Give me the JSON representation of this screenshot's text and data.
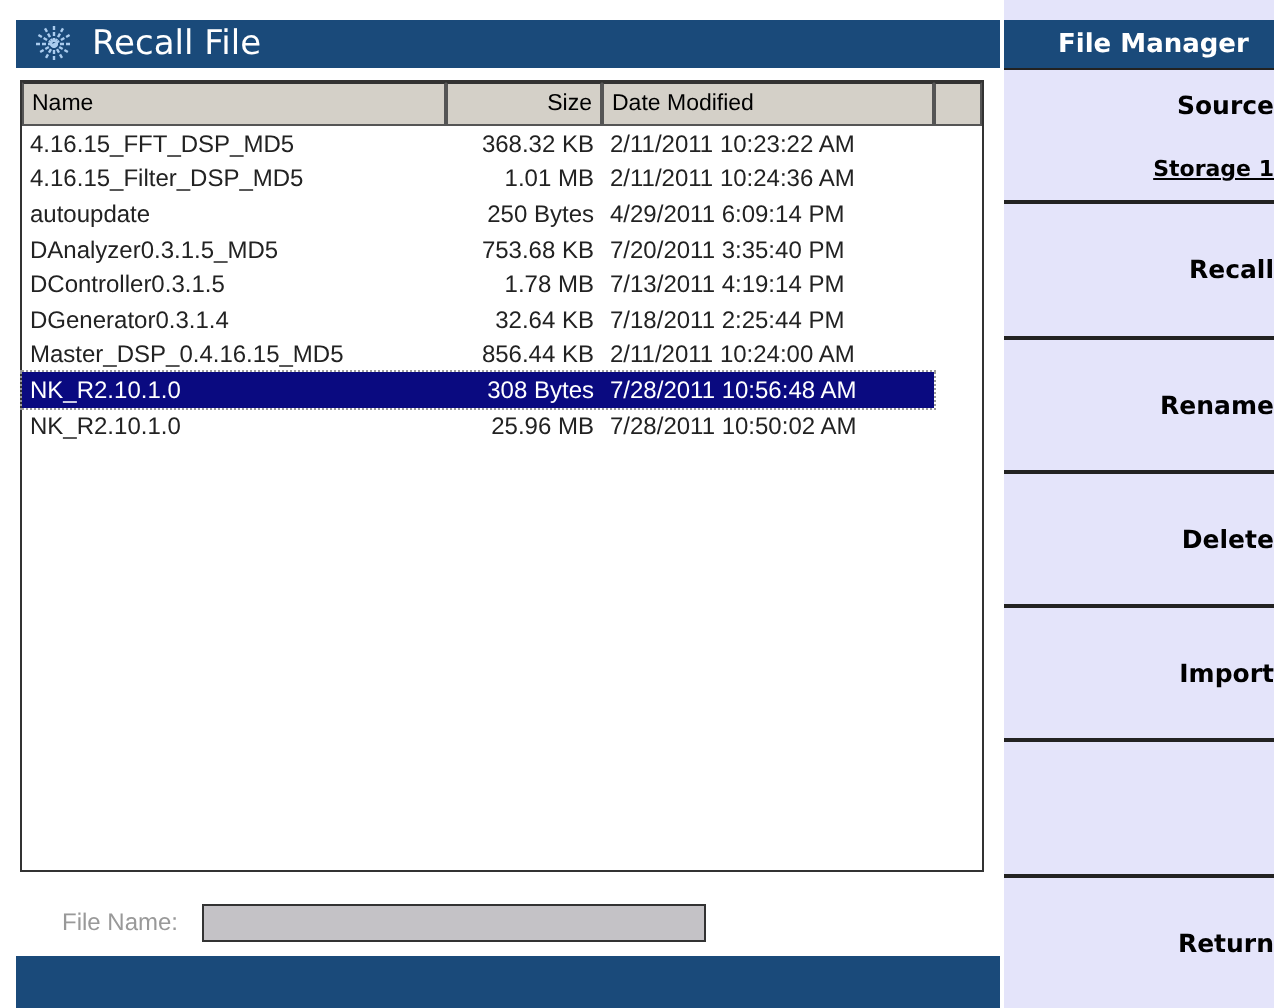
{
  "title": "Recall File",
  "table": {
    "columns": [
      "Name",
      "Size",
      "Date Modified"
    ],
    "rows": [
      {
        "name": "4.16.15_FFT_DSP_MD5",
        "size": "368.32 KB",
        "date": "2/11/2011 10:23:22 AM",
        "selected": false
      },
      {
        "name": "4.16.15_Filter_DSP_MD5",
        "size": "1.01 MB",
        "date": "2/11/2011 10:24:36 AM",
        "selected": false
      },
      {
        "name": "autoupdate",
        "size": "250 Bytes",
        "date": "4/29/2011 6:09:14 PM",
        "selected": false
      },
      {
        "name": "DAnalyzer0.3.1.5_MD5",
        "size": "753.68 KB",
        "date": "7/20/2011 3:35:40 PM",
        "selected": false
      },
      {
        "name": "DController0.3.1.5",
        "size": "1.78 MB",
        "date": "7/13/2011 4:19:14 PM",
        "selected": false
      },
      {
        "name": "DGenerator0.3.1.4",
        "size": "32.64 KB",
        "date": "7/18/2011 2:25:44 PM",
        "selected": false
      },
      {
        "name": "Master_DSP_0.4.16.15_MD5",
        "size": "856.44 KB",
        "date": "2/11/2011 10:24:00 AM",
        "selected": false
      },
      {
        "name": "NK_R2.10.1.0",
        "size": "308 Bytes",
        "date": "7/28/2011 10:56:48 AM",
        "selected": true
      },
      {
        "name": "NK_R2.10.1.0",
        "size": "25.96 MB",
        "date": "7/28/2011 10:50:02 AM",
        "selected": false
      }
    ]
  },
  "file_name": {
    "label": "File Name:"
  },
  "menu": {
    "title": "File Manager",
    "softkeys": [
      {
        "kind": "choice",
        "label": "Source",
        "value": "Storage 1"
      },
      {
        "kind": "action",
        "label": "Recall"
      },
      {
        "kind": "action",
        "label": "Rename"
      },
      {
        "kind": "action",
        "label": "Delete"
      },
      {
        "kind": "action",
        "label": "Import"
      },
      {
        "kind": "blank"
      },
      {
        "kind": "action",
        "label": "Return"
      }
    ]
  }
}
